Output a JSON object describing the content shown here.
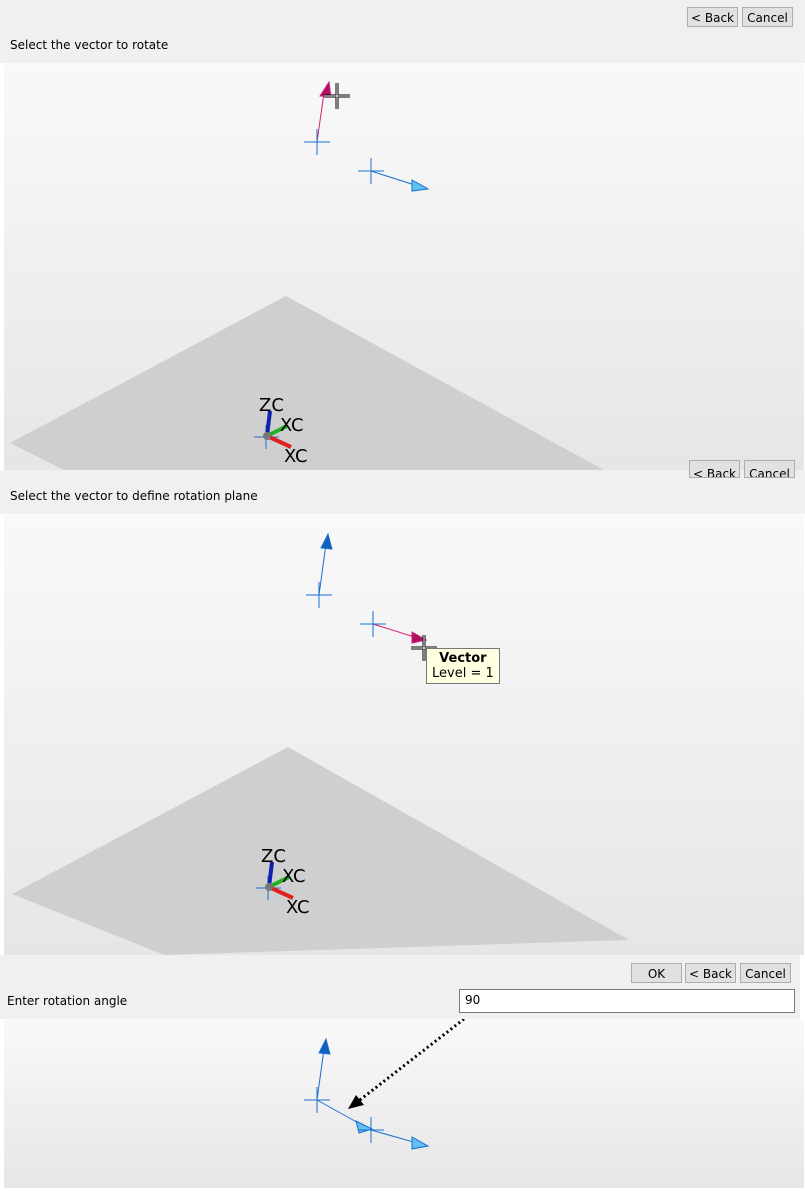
{
  "step1": {
    "prompt": "Select the vector to rotate",
    "buttons": {
      "back": "< Back",
      "cancel": "Cancel"
    }
  },
  "step2": {
    "prompt": "Select the vector to define rotation plane",
    "buttons": {
      "back": "< Back",
      "cancel": "Cancel"
    },
    "tooltip": {
      "title": "Vector",
      "detail": "Level = 1"
    }
  },
  "step3": {
    "prompt": "Enter rotation angle",
    "angle_value": "90",
    "buttons": {
      "ok": "OK",
      "back": "< Back",
      "cancel": "Cancel"
    }
  },
  "triad": {
    "z": "ZC",
    "y": "XC",
    "x": "XC"
  },
  "colors": {
    "vector": "#1a6fd0",
    "selected": "#d0207a",
    "x_axis": "#e02020",
    "y_axis": "#20b020",
    "z_axis": "#1020b0"
  }
}
